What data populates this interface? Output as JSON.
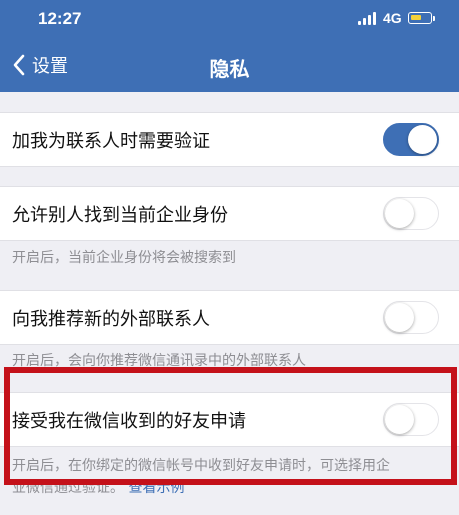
{
  "status_bar": {
    "time": "12:27",
    "network": "4G",
    "battery_level": 0.6
  },
  "nav": {
    "back_label": "设置",
    "title": "隐私"
  },
  "settings": [
    {
      "label": "加我为联系人时需要验证",
      "enabled": true,
      "description": ""
    },
    {
      "label": "允许别人找到当前企业身份",
      "enabled": false,
      "description": "开启后，当前企业身份将会被搜索到"
    },
    {
      "label": "向我推荐新的外部联系人",
      "enabled": false,
      "description": "开启后，会向你推荐微信通讯录中的外部联系人"
    },
    {
      "label": "接受我在微信收到的好友申请",
      "enabled": false,
      "description_line1": "开启后，在你绑定的微信帐号中收到好友申请时，可选择用企",
      "description_line2": "业微信通过验证。",
      "description_link": "查看示例"
    }
  ],
  "colors": {
    "accent": "#3e6fb5",
    "highlight": "#c4111a",
    "background": "#efeff4"
  }
}
